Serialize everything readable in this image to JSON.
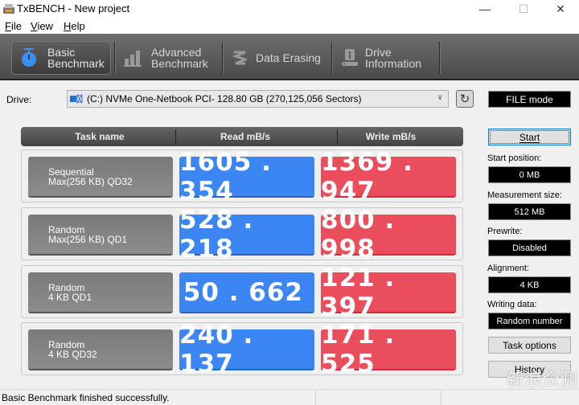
{
  "window": {
    "title": "TxBENCH - New project",
    "minimize_glyph": "—",
    "maximize_glyph": "☐",
    "close_glyph": "✕"
  },
  "menu": [
    {
      "label": "File",
      "accel": "F",
      "rest": "ile"
    },
    {
      "label": "View",
      "accel": "V",
      "rest": "iew"
    },
    {
      "label": "Help",
      "accel": "H",
      "rest": "elp"
    }
  ],
  "toolbar": {
    "tabs": [
      {
        "line1": "Basic",
        "line2": "Benchmark",
        "icon": "stopwatch-icon",
        "active": true
      },
      {
        "line1": "Advanced",
        "line2": "Benchmark",
        "icon": "bar-chart-icon",
        "active": false
      },
      {
        "line1": "Data Erasing",
        "line2": "",
        "icon": "eraser-icon",
        "active": false
      },
      {
        "line1": "Drive",
        "line2": "Information",
        "icon": "drive-info-icon",
        "active": false
      }
    ]
  },
  "drive": {
    "label": "Drive:",
    "selected": "(C:) NVMe One-Netbook PCI-  128.80 GB (270,125,056 Sectors)"
  },
  "mode_badge": "FILE mode",
  "table": {
    "headers": [
      "Task name",
      "Read mB/s",
      "Write mB/s"
    ],
    "rows": [
      {
        "line1": "Sequential",
        "line2": "Max(256 KB) QD32",
        "read": "1605.354",
        "write": "1369.947"
      },
      {
        "line1": "Random",
        "line2": "Max(256 KB) QD1",
        "read": "528.218",
        "write": "800.998"
      },
      {
        "line1": "Random",
        "line2": "4 KB QD1",
        "read": "50.662",
        "write": "121.397"
      },
      {
        "line1": "Random",
        "line2": "4 KB QD32",
        "read": "240.137",
        "write": "171.525"
      }
    ]
  },
  "side": {
    "start_label": "Start",
    "start_position_label": "Start position:",
    "start_position_value": "0 MB",
    "measurement_size_label": "Measurement size:",
    "measurement_size_value": "512 MB",
    "prewrite_label": "Prewrite:",
    "prewrite_value": "Disabled",
    "alignment_label": "Alignment:",
    "alignment_value": "4 KB",
    "writing_data_label": "Writing data:",
    "writing_data_value": "Random number",
    "task_options_label": "Task options",
    "history_label": "History"
  },
  "status": {
    "message": "Basic Benchmark finished successfully."
  },
  "watermark": "新浪众测",
  "colors": {
    "read": "#3b86f2",
    "write": "#ea4e5d",
    "active_icon": "#3a8ff0"
  }
}
